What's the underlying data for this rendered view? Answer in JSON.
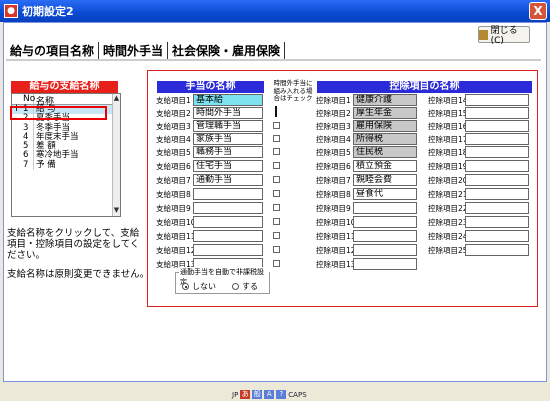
{
  "window": {
    "title": "初期設定2",
    "close_glyph": "X",
    "close_button_label": "閉じる(C)"
  },
  "tabs": [
    {
      "label": "給与の項目名称"
    },
    {
      "label": "時間外手当"
    },
    {
      "label": "社会保険・雇用保険"
    }
  ],
  "pay_list": {
    "header": "給与の支給名称",
    "col_no": "No",
    "col_name": "名称",
    "rows": [
      {
        "no": "1",
        "name": "給 与"
      },
      {
        "no": "2",
        "name": "夏季手当"
      },
      {
        "no": "3",
        "name": "冬季手当"
      },
      {
        "no": "4",
        "name": "年度末手当"
      },
      {
        "no": "5",
        "name": "差 額"
      },
      {
        "no": "6",
        "name": "寒冷地手当"
      },
      {
        "no": "7",
        "name": "予 備"
      }
    ],
    "indicator": "I"
  },
  "instructions": {
    "line1": "支給名称をクリックして、支給項目・控除項目の設定をしてください。",
    "line2": "支給名称は原則変更できません。"
  },
  "allowances": {
    "header": "手当の名称",
    "check_note": "時間外手当に組み入れる場合はチェック",
    "items": [
      {
        "label": "支給項目1",
        "value": "基本給"
      },
      {
        "label": "支給項目2",
        "value": "時間外手当"
      },
      {
        "label": "支給項目3",
        "value": "管理職手当"
      },
      {
        "label": "支給項目4",
        "value": "家族手当"
      },
      {
        "label": "支給項目5",
        "value": "職務手当"
      },
      {
        "label": "支給項目6",
        "value": "住宅手当"
      },
      {
        "label": "支給項目7",
        "value": "通勤手当"
      },
      {
        "label": "支給項目8",
        "value": ""
      },
      {
        "label": "支給項目9",
        "value": ""
      },
      {
        "label": "支給項目10",
        "value": ""
      },
      {
        "label": "支給項目11",
        "value": ""
      },
      {
        "label": "支給項目12",
        "value": ""
      },
      {
        "label": "支給項目13",
        "value": ""
      }
    ]
  },
  "deductions": {
    "header": "控除項目の名称",
    "items": [
      {
        "label": "控除項目1",
        "value": "健康介護"
      },
      {
        "label": "控除項目2",
        "value": "厚生年金"
      },
      {
        "label": "控除項目3",
        "value": "雇用保険"
      },
      {
        "label": "控除項目4",
        "value": "所得税"
      },
      {
        "label": "控除項目5",
        "value": "住民税"
      },
      {
        "label": "控除項目6",
        "value": "積立預金"
      },
      {
        "label": "控除項目7",
        "value": "親睦会費"
      },
      {
        "label": "控除項目8",
        "value": "昼食代"
      },
      {
        "label": "控除項目9",
        "value": ""
      },
      {
        "label": "控除項目10",
        "value": ""
      },
      {
        "label": "控除項目11",
        "value": ""
      },
      {
        "label": "控除項目12",
        "value": ""
      },
      {
        "label": "控除項目13",
        "value": ""
      },
      {
        "label": "控除項目14",
        "value": ""
      },
      {
        "label": "控除項目15",
        "value": ""
      },
      {
        "label": "控除項目16",
        "value": ""
      },
      {
        "label": "控除項目17",
        "value": ""
      },
      {
        "label": "控除項目18",
        "value": ""
      },
      {
        "label": "控除項目19",
        "value": ""
      },
      {
        "label": "控除項目20",
        "value": ""
      },
      {
        "label": "控除項目21",
        "value": ""
      },
      {
        "label": "控除項目22",
        "value": ""
      },
      {
        "label": "控除項目23",
        "value": ""
      },
      {
        "label": "控除項目24",
        "value": ""
      },
      {
        "label": "控除項目25",
        "value": ""
      }
    ]
  },
  "tax_setting": {
    "title": "通勤手当を自動で非課税設定",
    "option_no": "しない",
    "option_yes": "する",
    "selected": "しない"
  },
  "taskbar": {
    "items": [
      "JP",
      "あ",
      "般",
      "A",
      "?",
      "CAPS"
    ]
  }
}
